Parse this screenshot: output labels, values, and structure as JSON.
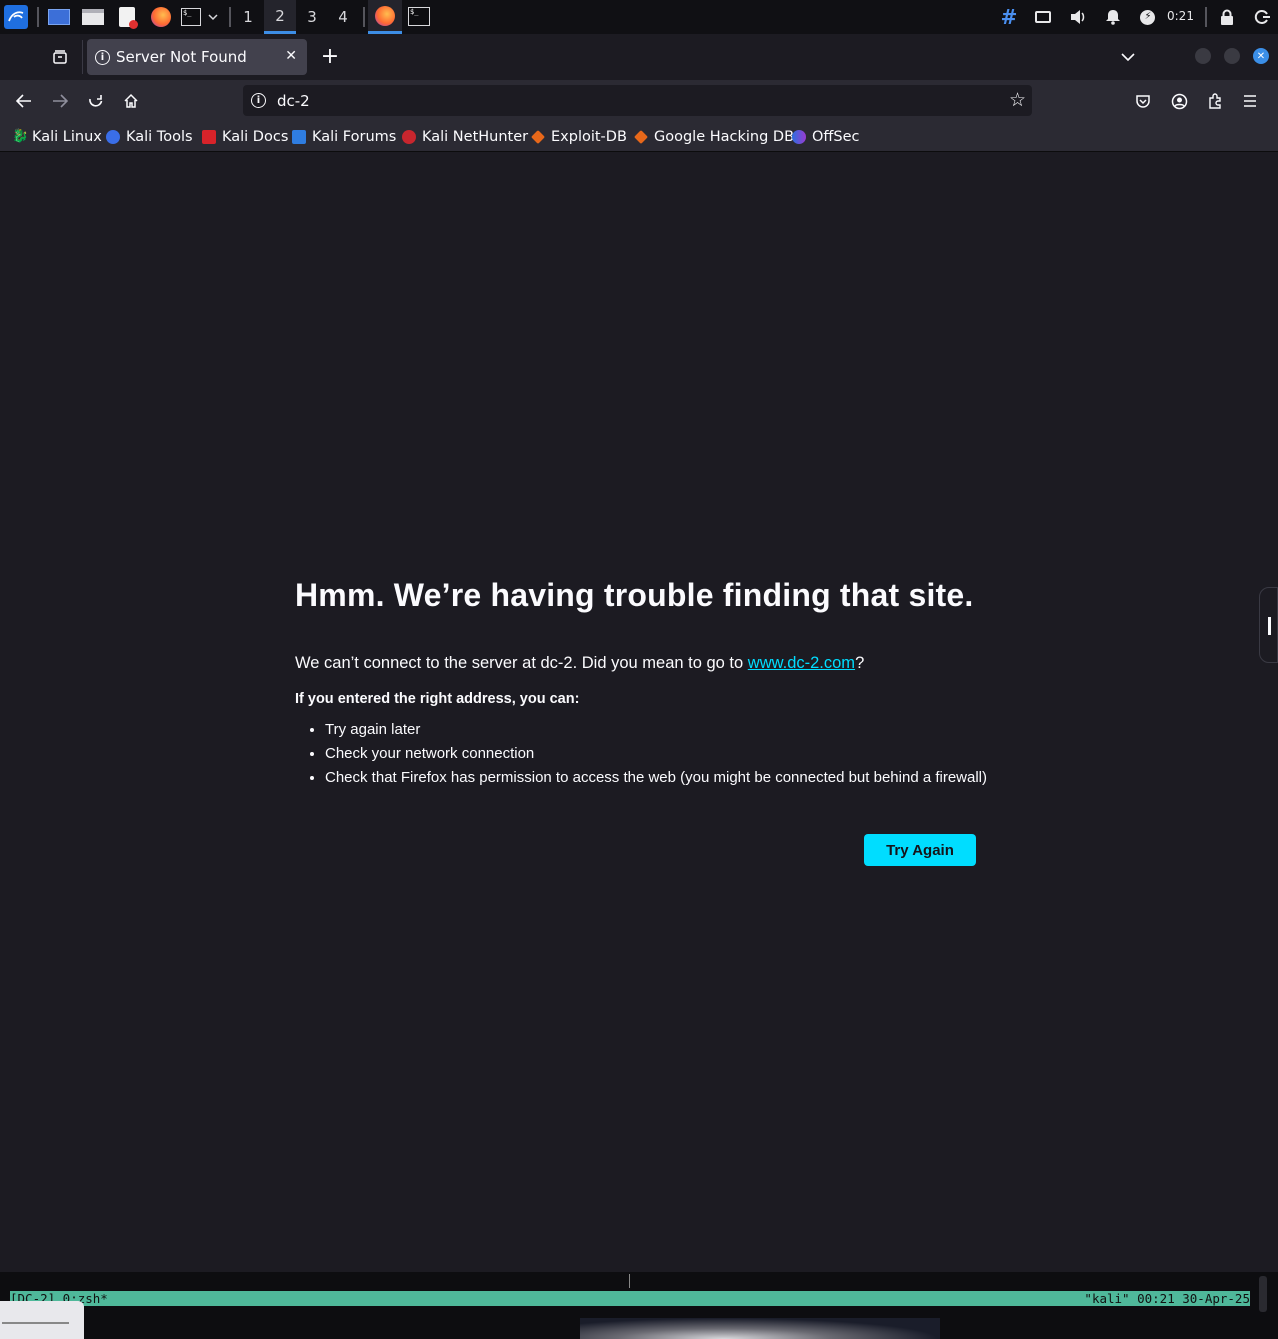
{
  "taskbar": {
    "workspaces": [
      "1",
      "2",
      "3",
      "4"
    ],
    "active_workspace": "2",
    "clock": "0:21"
  },
  "browser": {
    "tab_title": "Server Not Found",
    "url": "dc-2",
    "bookmarks": [
      "Kali Linux",
      "Kali Tools",
      "Kali Docs",
      "Kali Forums",
      "Kali NetHunter",
      "Exploit-DB",
      "Google Hacking DB",
      "OffSec"
    ]
  },
  "error_page": {
    "title": "Hmm. We’re having trouble finding that site.",
    "desc_prefix": "We can’t connect to the server at dc-2. Did you mean to go to ",
    "desc_link": "www.dc-2.com",
    "desc_suffix": "?",
    "subtitle": "If you entered the right address, you can:",
    "suggestions": [
      "Try again later",
      "Check your network connection",
      "Check that Firefox has permission to access the web (you might be connected but behind a firewall)"
    ],
    "button": "Try Again"
  },
  "terminal": {
    "status_left": "[DC-2] 0:zsh*",
    "status_right": "\"kali\" 00:21 30-Apr-25"
  },
  "colors": {
    "accent": "#00ddff",
    "page_bg": "#1c1b22",
    "toolbar_bg": "#2b2a33",
    "tmux_status": "#4fb89a"
  }
}
